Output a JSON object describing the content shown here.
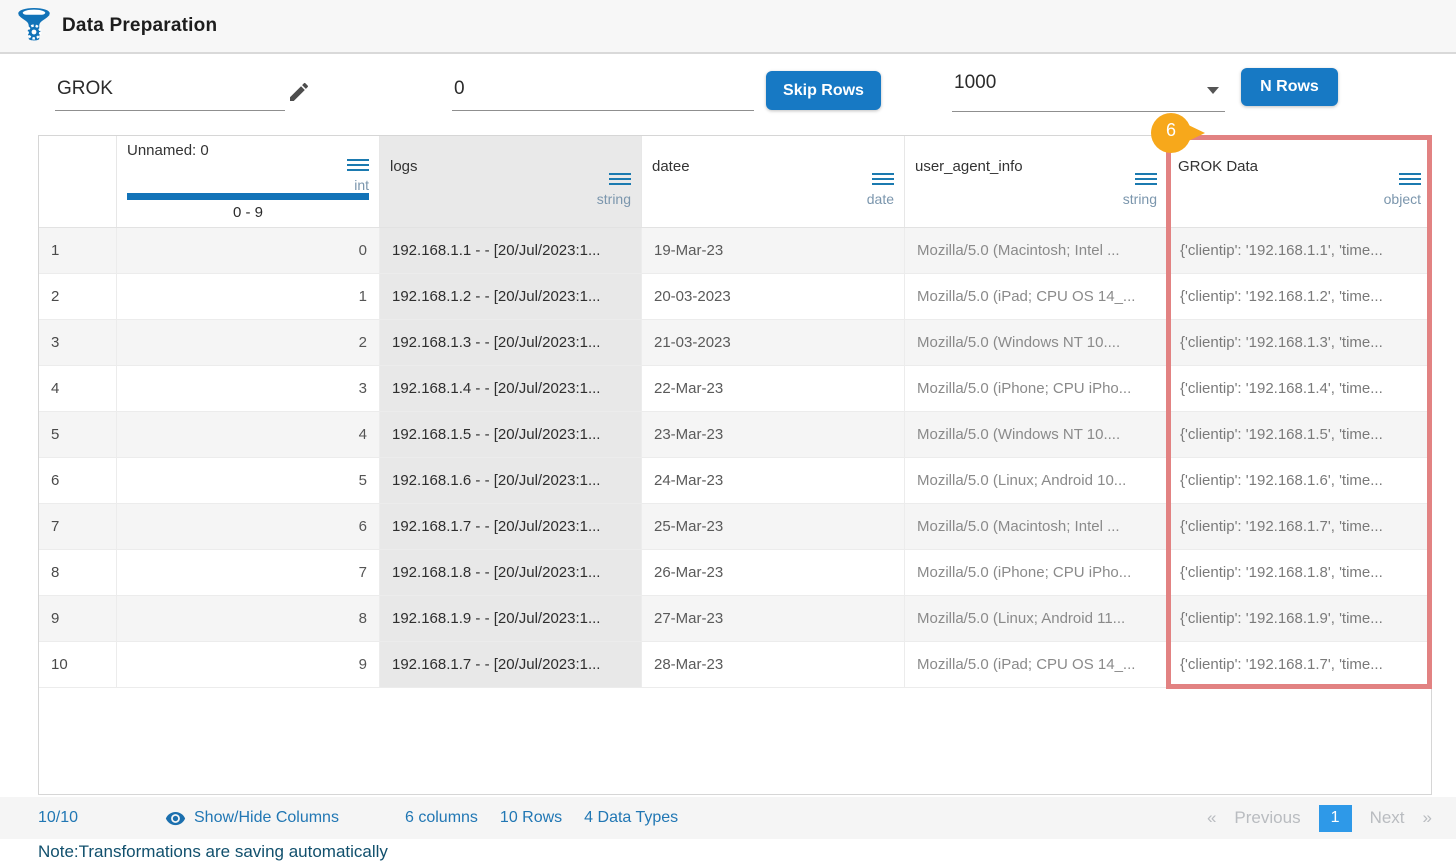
{
  "header": {
    "title": "Data Preparation"
  },
  "toolbar": {
    "grok_value": "GROK",
    "skip_value": "0",
    "skip_button": "Skip Rows",
    "nrows_value": "1000",
    "nrows_button": "N Rows"
  },
  "table": {
    "badge": "6",
    "columns": [
      {
        "name": "Unnamed: 0",
        "type": "int",
        "range": "0 - 9"
      },
      {
        "name": "logs",
        "type": "string"
      },
      {
        "name": "datee",
        "type": "date"
      },
      {
        "name": "user_agent_info",
        "type": "string"
      },
      {
        "name": "GROK Data",
        "type": "object"
      }
    ],
    "rows": [
      {
        "index": "1",
        "unnamed": "0",
        "logs": "192.168.1.1 - - [20/Jul/2023:1...",
        "datee": "19-Mar-23",
        "user_agent": "Mozilla/5.0 (Macintosh; Intel ...",
        "grok": "{'clientip': '192.168.1.1', 'time..."
      },
      {
        "index": "2",
        "unnamed": "1",
        "logs": "192.168.1.2 - - [20/Jul/2023:1...",
        "datee": "20-03-2023",
        "user_agent": "Mozilla/5.0 (iPad; CPU OS 14_...",
        "grok": "{'clientip': '192.168.1.2', 'time..."
      },
      {
        "index": "3",
        "unnamed": "2",
        "logs": "192.168.1.3 - - [20/Jul/2023:1...",
        "datee": "21-03-2023",
        "user_agent": "Mozilla/5.0 (Windows NT 10....",
        "grok": "{'clientip': '192.168.1.3', 'time..."
      },
      {
        "index": "4",
        "unnamed": "3",
        "logs": "192.168.1.4 - - [20/Jul/2023:1...",
        "datee": "22-Mar-23",
        "user_agent": "Mozilla/5.0 (iPhone; CPU iPho...",
        "grok": "{'clientip': '192.168.1.4', 'time..."
      },
      {
        "index": "5",
        "unnamed": "4",
        "logs": "192.168.1.5 - - [20/Jul/2023:1...",
        "datee": "23-Mar-23",
        "user_agent": "Mozilla/5.0 (Windows NT 10....",
        "grok": "{'clientip': '192.168.1.5', 'time..."
      },
      {
        "index": "6",
        "unnamed": "5",
        "logs": "192.168.1.6 - - [20/Jul/2023:1...",
        "datee": "24-Mar-23",
        "user_agent": "Mozilla/5.0 (Linux; Android 10...",
        "grok": "{'clientip': '192.168.1.6', 'time..."
      },
      {
        "index": "7",
        "unnamed": "6",
        "logs": "192.168.1.7 - - [20/Jul/2023:1...",
        "datee": "25-Mar-23",
        "user_agent": "Mozilla/5.0 (Macintosh; Intel ...",
        "grok": "{'clientip': '192.168.1.7', 'time..."
      },
      {
        "index": "8",
        "unnamed": "7",
        "logs": "192.168.1.8 - - [20/Jul/2023:1...",
        "datee": "26-Mar-23",
        "user_agent": "Mozilla/5.0 (iPhone; CPU iPho...",
        "grok": "{'clientip': '192.168.1.8', 'time..."
      },
      {
        "index": "9",
        "unnamed": "8",
        "logs": "192.168.1.9 - - [20/Jul/2023:1...",
        "datee": "27-Mar-23",
        "user_agent": "Mozilla/5.0 (Linux; Android 11...",
        "grok": "{'clientip': '192.168.1.9', 'time..."
      },
      {
        "index": "10",
        "unnamed": "9",
        "logs": "192.168.1.7 - - [20/Jul/2023:1...",
        "datee": "28-Mar-23",
        "user_agent": "Mozilla/5.0 (iPad; CPU OS 14_...",
        "grok": "{'clientip': '192.168.1.7', 'time..."
      }
    ]
  },
  "footer": {
    "count": "10/10",
    "show_hide": "Show/Hide Columns",
    "columns_label": "6 columns",
    "rows_label": "10 Rows",
    "types_label": "4 Data Types",
    "prev_arrow": "«",
    "previous": "Previous",
    "page": "1",
    "next": "Next",
    "next_arrow": "»"
  },
  "note": "Note:Transformations are saving automatically",
  "colors": {
    "accent": "#1779c4",
    "bar_blue": "#1273b8",
    "badge_orange": "#f7a81b",
    "highlight_red": "#e28282",
    "footer_blue": "#2177b4",
    "note_color": "#11506d",
    "type_label": "#7b96ad",
    "page_active": "#2e99e8"
  }
}
